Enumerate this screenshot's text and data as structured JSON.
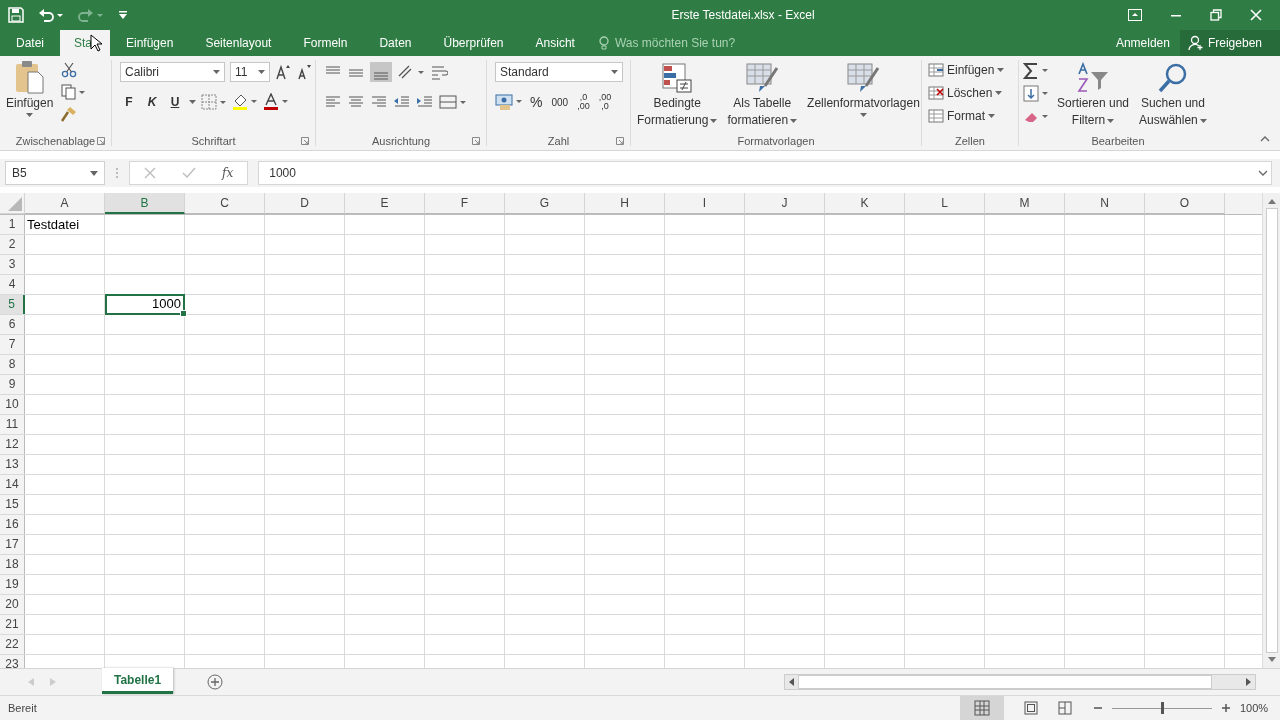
{
  "window": {
    "title": "Erste Testdatei.xlsx - Excel"
  },
  "tabs": [
    {
      "label": "Datei",
      "selected": false
    },
    {
      "label": "Sta",
      "selected": true
    },
    {
      "label": "Einfügen",
      "selected": false
    },
    {
      "label": "Seitenlayout",
      "selected": false
    },
    {
      "label": "Formeln",
      "selected": false
    },
    {
      "label": "Daten",
      "selected": false
    },
    {
      "label": "Überprüfen",
      "selected": false
    },
    {
      "label": "Ansicht",
      "selected": false
    }
  ],
  "tell_me": {
    "placeholder": "Was möchten Sie tun?"
  },
  "account": {
    "sign_in": "Anmelden",
    "share": "Freigeben"
  },
  "ribbon": {
    "clipboard": {
      "title": "Zwischenablage",
      "paste": "Einfügen"
    },
    "font": {
      "title": "Schriftart",
      "family": "Calibri",
      "size": "11",
      "bold": "F",
      "italic": "K",
      "underline": "U"
    },
    "alignment": {
      "title": "Ausrichtung"
    },
    "number": {
      "title": "Zahl",
      "format": "Standard",
      "percent": "%",
      "thousands": "000",
      "decimals": [
        {
          "top": ",0",
          "bottom": ",00"
        },
        {
          "top": ",00",
          "bottom": ",0"
        }
      ]
    },
    "styles": {
      "title": "Formatvorlagen",
      "buttons": [
        {
          "line1": "Bedingte",
          "line2": "Formatierung"
        },
        {
          "line1": "Als Tabelle",
          "line2": "formatieren"
        },
        {
          "line1": "Zellenformatvorlagen"
        }
      ]
    },
    "cells": {
      "title": "Zellen",
      "buttons": [
        "Einfügen",
        "Löschen",
        "Format"
      ]
    },
    "editing": {
      "title": "Bearbeiten",
      "buttons": [
        {
          "line1": "Sortieren und",
          "line2": "Filtern"
        },
        {
          "line1": "Suchen und",
          "line2": "Auswählen"
        }
      ]
    }
  },
  "formula_bar": {
    "name_box": "B5",
    "fx": "fx",
    "value": "1000"
  },
  "sheet": {
    "columns": [
      {
        "label": "A",
        "selected": false
      },
      {
        "label": "B",
        "selected": true
      },
      {
        "label": "C",
        "selected": false
      },
      {
        "label": "D",
        "selected": false
      },
      {
        "label": "E",
        "selected": false
      },
      {
        "label": "F",
        "selected": false
      },
      {
        "label": "G",
        "selected": false
      },
      {
        "label": "H",
        "selected": false
      },
      {
        "label": "I",
        "selected": false
      },
      {
        "label": "J",
        "selected": false
      },
      {
        "label": "K",
        "selected": false
      },
      {
        "label": "L",
        "selected": false
      },
      {
        "label": "M",
        "selected": false
      },
      {
        "label": "N",
        "selected": false
      },
      {
        "label": "O",
        "selected": false
      }
    ],
    "rows": [
      {
        "label": "1",
        "selected": false,
        "cells": [
          {
            "value": "Testdatei",
            "kind": "text"
          }
        ]
      },
      {
        "label": "2",
        "selected": false,
        "cells": []
      },
      {
        "label": "3",
        "selected": false,
        "cells": []
      },
      {
        "label": "4",
        "selected": false,
        "cells": []
      },
      {
        "label": "5",
        "selected": true,
        "cells": [
          {
            "kind": "empty"
          },
          {
            "value": "1000",
            "kind": "number",
            "selected": true
          }
        ]
      },
      {
        "label": "6",
        "selected": false,
        "cells": []
      },
      {
        "label": "7",
        "selected": false,
        "cells": []
      },
      {
        "label": "8",
        "selected": false,
        "cells": []
      },
      {
        "label": "9",
        "selected": false,
        "cells": []
      },
      {
        "label": "10",
        "selected": false,
        "cells": []
      },
      {
        "label": "11",
        "selected": false,
        "cells": []
      },
      {
        "label": "12",
        "selected": false,
        "cells": []
      },
      {
        "label": "13",
        "selected": false,
        "cells": []
      },
      {
        "label": "14",
        "selected": false,
        "cells": []
      },
      {
        "label": "15",
        "selected": false,
        "cells": []
      },
      {
        "label": "16",
        "selected": false,
        "cells": []
      },
      {
        "label": "17",
        "selected": false,
        "cells": []
      },
      {
        "label": "18",
        "selected": false,
        "cells": []
      },
      {
        "label": "19",
        "selected": false,
        "cells": []
      },
      {
        "label": "20",
        "selected": false,
        "cells": []
      },
      {
        "label": "21",
        "selected": false,
        "cells": []
      },
      {
        "label": "22",
        "selected": false,
        "cells": []
      },
      {
        "label": "23",
        "selected": false,
        "cells": []
      }
    ]
  },
  "sheet_tabs": [
    {
      "label": "Tabelle1",
      "selected": true
    }
  ],
  "status_bar": {
    "status": "Bereit",
    "zoom": "100%",
    "zoom_level": {
      "level": 0.5
    }
  }
}
